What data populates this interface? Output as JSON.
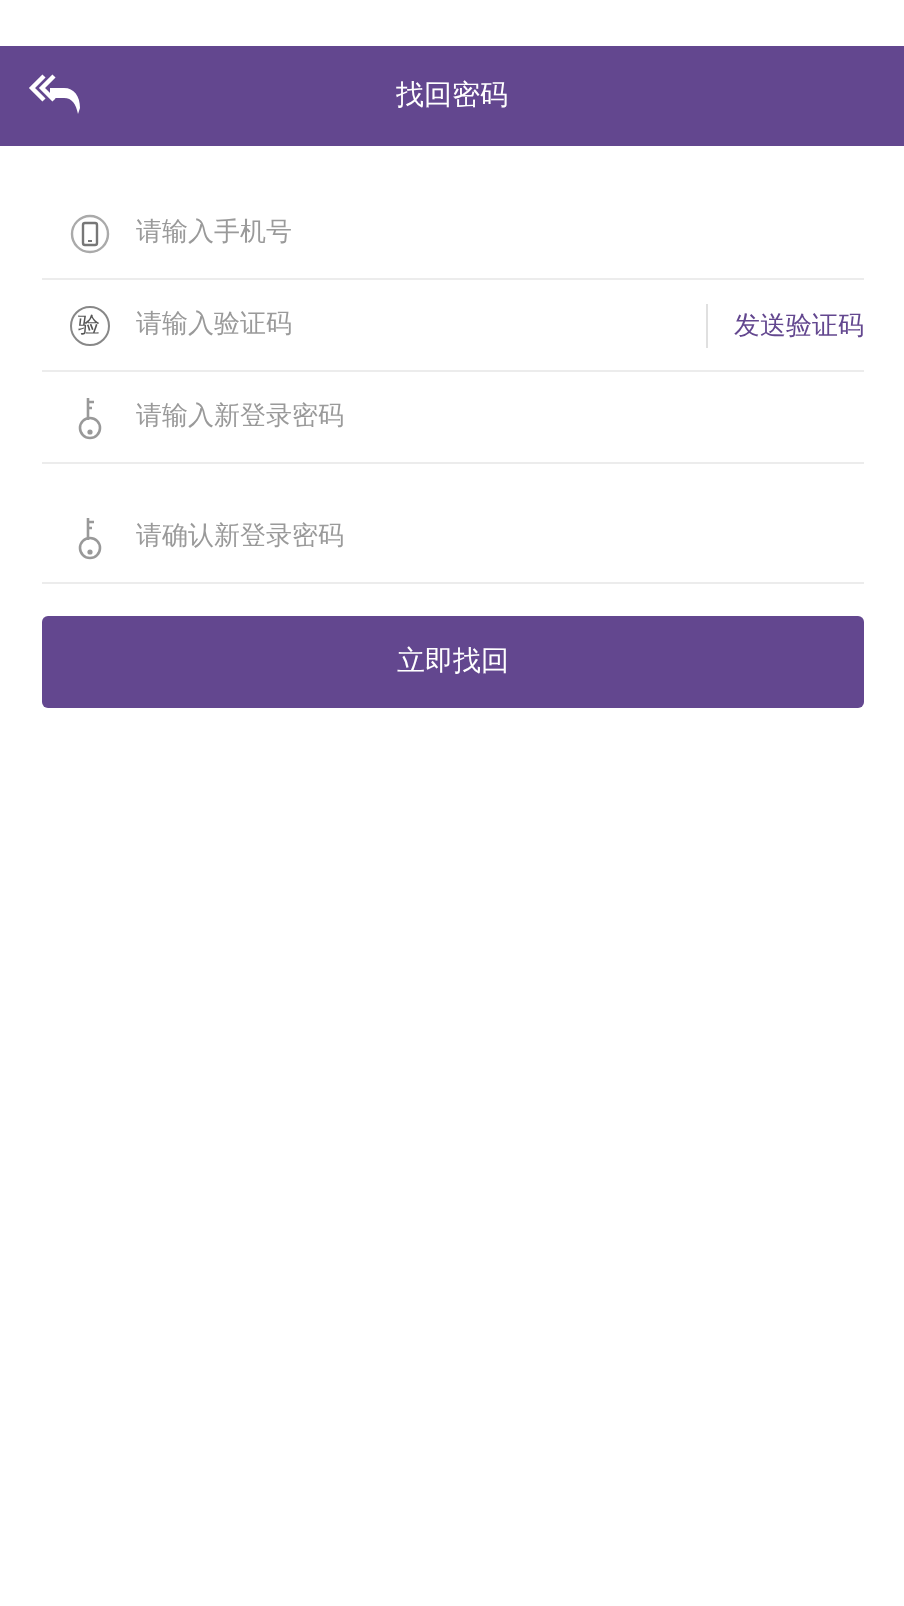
{
  "header": {
    "title": "找回密码"
  },
  "fields": [
    {
      "kind": "phone",
      "placeholder": "请输入手机号"
    },
    {
      "kind": "badge",
      "icon_text": "验",
      "placeholder": "请输入验证码",
      "action": "发送验证码"
    },
    {
      "kind": "key",
      "placeholder": "请输入新登录密码"
    },
    {
      "kind": "key",
      "placeholder": "请确认新登录密码"
    }
  ],
  "submit": "立即找回"
}
